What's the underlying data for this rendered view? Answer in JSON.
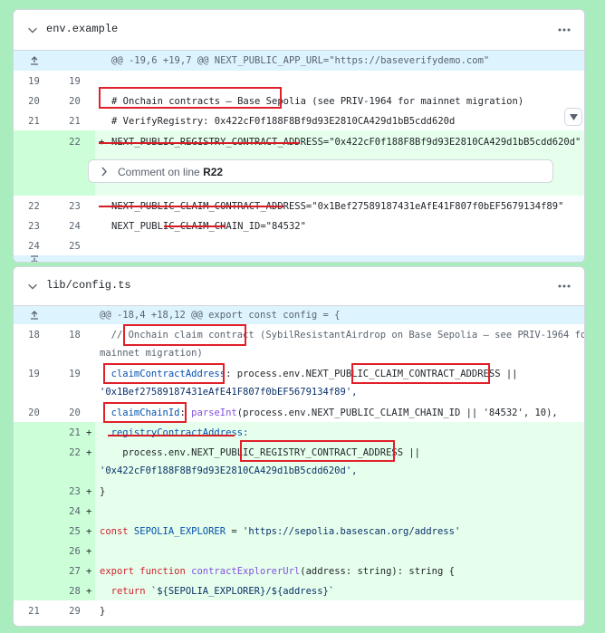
{
  "files": [
    {
      "name": "env.example",
      "hunk": "@@ -19,6 +19,7 @@ NEXT_PUBLIC_APP_URL=\"https://baseverifydemo.com\"",
      "lines": [
        {
          "old": "19",
          "new": "19",
          "text": ""
        },
        {
          "old": "20",
          "new": "20",
          "text": "# Onchain contracts — Base Sepolia (see PRIV-1964 for mainnet migration)"
        },
        {
          "old": "21",
          "new": "21",
          "text": "# VerifyRegistry: 0x422cF0f188F8Bf9d93E2810CA429d1bB5cdd620d"
        },
        {
          "old": "",
          "new": "22",
          "sign": "+",
          "text": "NEXT_PUBLIC_REGISTRY_CONTRACT_ADDRESS=\"0x422cF0f188F8Bf9d93E2810CA429d1bB5cdd620d\""
        },
        {
          "old": "22",
          "new": "23",
          "text": "NEXT_PUBLIC_CLAIM_CONTRACT_ADDRESS=\"0x1Bef27589187431eAfE41F807f0bEF5679134f89\""
        },
        {
          "old": "23",
          "new": "24",
          "text": "NEXT_PUBLIC_CLAIM_CHAIN_ID=\"84532\""
        },
        {
          "old": "24",
          "new": "25",
          "text": ""
        }
      ],
      "comment": {
        "label": "Comment on line",
        "line": "R22"
      }
    },
    {
      "name": "lib/config.ts",
      "hunk": "@@ -18,4 +18,12 @@ export const config = {",
      "lines": [
        {
          "old": "18",
          "new": "18",
          "text_a": "  // Onchain claim contract (SybilResistantAirdrop on Base Sepolia — see PRIV-1964 for",
          "text_b": "mainnet migration)"
        },
        {
          "old": "19",
          "new": "19",
          "p1": "  claimContractAddress",
          "p2": ": process.env.NEXT_PUBLIC_CLAIM_CONTRACT_ADDRESS ||",
          "p3": "'0x1Bef27589187431eAfE41F807f0bEF5679134f89',"
        },
        {
          "old": "20",
          "new": "20",
          "p1": "  claimChainId",
          "p2": ": ",
          "p3": "parseInt",
          "p4": "(process.env.NEXT_PUBLIC_CLAIM_CHAIN_ID || '84532', 10),"
        },
        {
          "old": "",
          "new": "21",
          "sign": "+",
          "text": "  registryContractAddress:"
        },
        {
          "old": "",
          "new": "22",
          "sign": "+",
          "p1": "    process.env.NEXT_PUBLIC_REGISTRY_CONTRACT_ADDRESS ||",
          "p2": "'0x422cF0f188F8Bf9d93E2810CA429d1bB5cdd620d',"
        },
        {
          "old": "",
          "new": "23",
          "sign": "+",
          "text": "}"
        },
        {
          "old": "",
          "new": "24",
          "sign": "+",
          "text": ""
        },
        {
          "old": "",
          "new": "25",
          "sign": "+",
          "p1": "const",
          "p2": " SEPOLIA_EXPLORER",
          "p3": " = ",
          "p4": "'https://sepolia.basescan.org/address'"
        },
        {
          "old": "",
          "new": "26",
          "sign": "+",
          "text": ""
        },
        {
          "old": "",
          "new": "27",
          "sign": "+",
          "p1": "export function",
          "p2": " contractExplorerUrl",
          "p3": "(address: string): string {"
        },
        {
          "old": "",
          "new": "28",
          "sign": "+",
          "p1": "  return",
          "p2": " `${SEPOLIA_EXPLORER}/${address}`"
        },
        {
          "old": "21",
          "new": "29",
          "text": "}"
        }
      ]
    }
  ],
  "colors": {
    "added": "#e6ffec",
    "hunk": "#ddf4ff",
    "annotation": "#e0202a"
  },
  "icons": [
    "chevron-down-icon",
    "kebab-icon",
    "expand-up-icon",
    "expand-down-icon",
    "chevron-right-icon",
    "scroll-down-icon"
  ]
}
